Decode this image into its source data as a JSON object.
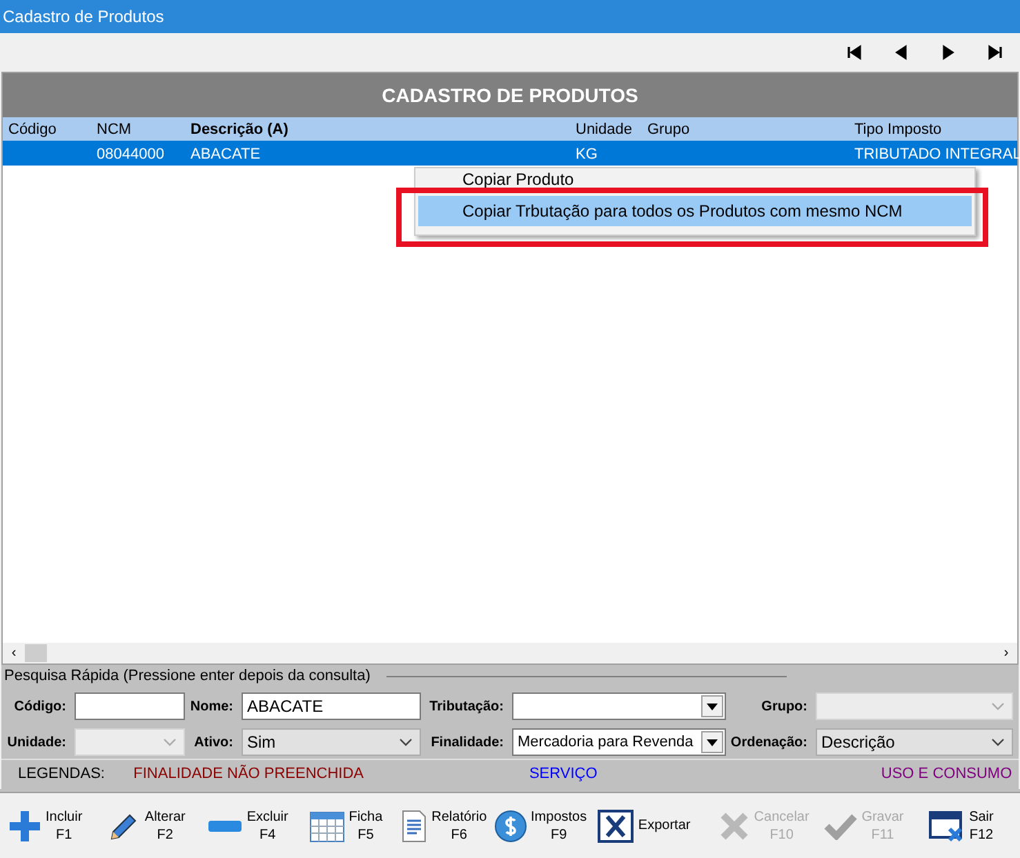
{
  "window": {
    "title": "Cadastro de Produtos"
  },
  "grid": {
    "title": "CADASTRO DE PRODUTOS",
    "columns": [
      {
        "label": "Código",
        "bold": false
      },
      {
        "label": "NCM",
        "bold": false
      },
      {
        "label": "Descrição (A)",
        "bold": true
      },
      {
        "label": "Unidade",
        "bold": false
      },
      {
        "label": "Grupo",
        "bold": false
      },
      {
        "label": "Tipo Imposto",
        "bold": false
      }
    ],
    "rows": [
      {
        "selected": true,
        "cells": [
          "",
          "08044000",
          "ABACATE",
          "KG",
          "",
          "TRIBUTADO INTEGRAL"
        ]
      }
    ]
  },
  "context_menu": {
    "items": [
      {
        "label": "Copiar Produto",
        "selected": false
      },
      {
        "label": "Copiar Trbutação para todos os Produtos com mesmo NCM",
        "selected": true
      }
    ]
  },
  "search": {
    "title": "Pesquisa Rápida (Pressione enter depois da consulta)",
    "fields": [
      {
        "label": "Código:",
        "kind": "text",
        "disabled": false
      },
      {
        "label": "Nome:",
        "kind": "text",
        "value": "ABACATE",
        "disabled": false
      },
      {
        "label": "Tributação:",
        "kind": "dropdown",
        "disabled": false
      },
      {
        "label": "Grupo:",
        "kind": "combo",
        "disabled": true
      },
      {
        "label": "Unidade:",
        "kind": "combo",
        "disabled": true
      },
      {
        "label": "Ativo:",
        "kind": "combo",
        "value": "Sim",
        "disabled": false
      },
      {
        "label": "Finalidade:",
        "kind": "dropdown",
        "value": "Mercadoria para Revenda",
        "disabled": false
      },
      {
        "label": "Ordenação:",
        "kind": "combo",
        "value": "Descrição",
        "disabled": false
      }
    ]
  },
  "scrollbar": {
    "left": "‹",
    "right": "›"
  },
  "legend": {
    "label": "LEGENDAS:",
    "items": [
      {
        "label": "FINALIDADE NÃO PREENCHIDA",
        "color": "#8b0000"
      },
      {
        "label": "SERVIÇO",
        "color": "#0000ff"
      },
      {
        "label": "USO E CONSUMO",
        "color": "#800080"
      }
    ]
  },
  "toolbar": [
    {
      "kind": "plus",
      "label": "Incluir",
      "key": "F1",
      "disabled": false
    },
    {
      "kind": "pencil",
      "label": "Alterar",
      "key": "F2",
      "disabled": false
    },
    {
      "kind": "minus",
      "label": "Excluir",
      "key": "F4",
      "disabled": false
    },
    {
      "kind": "calendar",
      "label": "Ficha",
      "key": "F5",
      "disabled": false
    },
    {
      "kind": "report",
      "label": "Relatório",
      "key": "F6",
      "disabled": false
    },
    {
      "kind": "dollar",
      "label": "Impostos",
      "key": "F9",
      "disabled": false
    },
    {
      "kind": "excel",
      "label": "Exportar",
      "disabled": false
    },
    {
      "kind": "cross",
      "label": "Cancelar",
      "key": "F10",
      "disabled": true
    },
    {
      "kind": "check",
      "label": "Gravar",
      "key": "F11",
      "disabled": true
    },
    {
      "kind": "exit",
      "label": "Sair",
      "key": "F12",
      "disabled": false
    }
  ]
}
